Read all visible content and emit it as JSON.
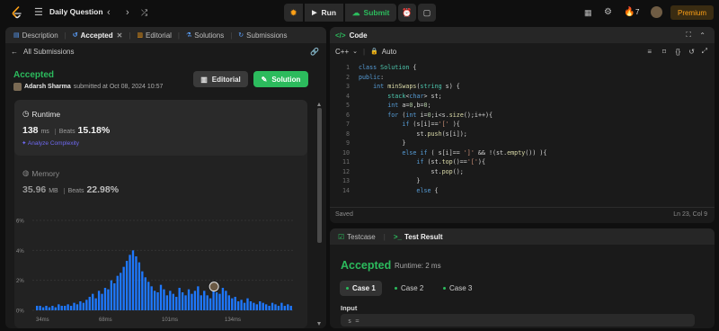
{
  "topbar": {
    "title": "Daily Question",
    "run_label": "Run",
    "submit_label": "Submit",
    "streak_count": "7",
    "premium_label": "Premium"
  },
  "left_panel": {
    "tabs": [
      {
        "label": "Description",
        "icon": "description-icon"
      },
      {
        "label": "Accepted",
        "icon": "accepted-icon",
        "active": true
      },
      {
        "label": "Editorial",
        "icon": "book-icon"
      },
      {
        "label": "Solutions",
        "icon": "flask-icon"
      },
      {
        "label": "Submissions",
        "icon": "history-icon"
      }
    ],
    "back_label": "All Submissions",
    "status": "Accepted",
    "user": "Adarsh Sharma",
    "submitted_text": "submitted at Oct 08, 2024 10:57",
    "editorial_button": "Editorial",
    "solution_button": "Solution",
    "runtime": {
      "label": "Runtime",
      "value": "138",
      "unit": "ms",
      "beats_label": "Beats",
      "beats": "15.18%",
      "analyze": "Analyze Complexity"
    },
    "memory": {
      "label": "Memory",
      "value": "35.96",
      "unit": "MB",
      "beats_label": "Beats",
      "beats": "22.98%"
    }
  },
  "chart_data": {
    "type": "bar",
    "y_ticks": [
      "6%",
      "4%",
      "2%",
      "0%"
    ],
    "ylim": [
      0,
      6
    ],
    "x_ticks": [
      "34ms",
      "68ms",
      "101ms",
      "134ms"
    ],
    "values": [
      0.3,
      0.3,
      0.2,
      0.3,
      0.2,
      0.3,
      0.2,
      0.4,
      0.3,
      0.3,
      0.4,
      0.3,
      0.5,
      0.4,
      0.6,
      0.5,
      0.7,
      0.9,
      1.1,
      0.8,
      1.3,
      1.1,
      1.5,
      1.4,
      2.0,
      1.8,
      2.3,
      2.5,
      2.9,
      3.3,
      3.7,
      4.0,
      3.6,
      3.2,
      2.6,
      2.2,
      1.9,
      1.6,
      1.3,
      1.2,
      1.7,
      1.4,
      1.0,
      1.3,
      1.1,
      0.9,
      1.5,
      1.2,
      1.0,
      1.4,
      1.1,
      1.3,
      1.6,
      1.0,
      1.3,
      1.0,
      0.8,
      1.4,
      1.2,
      1.1,
      1.5,
      1.3,
      1.0,
      0.8,
      0.9,
      0.6,
      0.7,
      0.5,
      0.8,
      0.6,
      0.5,
      0.4,
      0.6,
      0.5,
      0.4,
      0.3,
      0.5,
      0.4,
      0.3,
      0.5,
      0.3,
      0.4,
      0.3
    ],
    "highlight_index": 57,
    "bar_color": "#1e78ff",
    "grid": true
  },
  "code_panel": {
    "title": "Code",
    "language": "C++",
    "mode": "Auto",
    "lines": [
      {
        "n": "1",
        "html": "<span class=\"kw\">class</span> <span class=\"ty\">Solution</span> {"
      },
      {
        "n": "2",
        "html": "<span class=\"kw\">public</span>:"
      },
      {
        "n": "3",
        "html": "    <span class=\"kw\">int</span> <span class=\"fn\">minSwaps</span>(<span class=\"ty\">string</span> s) {"
      },
      {
        "n": "4",
        "html": "        <span class=\"ty\">stack</span>&lt;<span class=\"kw\">char</span>&gt; st;"
      },
      {
        "n": "5",
        "html": "        <span class=\"kw\">int</span> a=<span class=\"nm\">0</span>,b=<span class=\"nm\">0</span>;"
      },
      {
        "n": "6",
        "html": "        <span class=\"kw\">for</span> (<span class=\"kw\">int</span> i=<span class=\"nm\">0</span>;i&lt;s.<span class=\"fn\">size</span>();i++){"
      },
      {
        "n": "7",
        "html": "            <span class=\"kw\">if</span> (s[i]==<span class=\"st\">'['</span> ){"
      },
      {
        "n": "8",
        "html": "                st.<span class=\"fn\">push</span>(s[i]);"
      },
      {
        "n": "9",
        "html": "            }"
      },
      {
        "n": "10",
        "html": "            <span class=\"kw\">else if</span> ( s[i]== <span class=\"st\">']'</span> &amp;&amp; !(st.<span class=\"fn\">empty</span>()) ){"
      },
      {
        "n": "11",
        "html": "                <span class=\"kw\">if</span> (st.<span class=\"fn\">top</span>()==<span class=\"st\">'['</span>){"
      },
      {
        "n": "12",
        "html": "                    st.<span class=\"fn\">pop</span>();"
      },
      {
        "n": "13",
        "html": "                }"
      },
      {
        "n": "14",
        "html": "                <span class=\"kw\">else</span> {"
      }
    ],
    "saved": "Saved",
    "cursor": "Ln 23, Col 9"
  },
  "test_panel": {
    "tab_testcase": "Testcase",
    "tab_result": "Test Result",
    "status": "Accepted",
    "runtime": "Runtime: 2 ms",
    "cases": [
      "Case 1",
      "Case 2",
      "Case 3"
    ],
    "input_label": "Input",
    "input_value": "s ="
  }
}
